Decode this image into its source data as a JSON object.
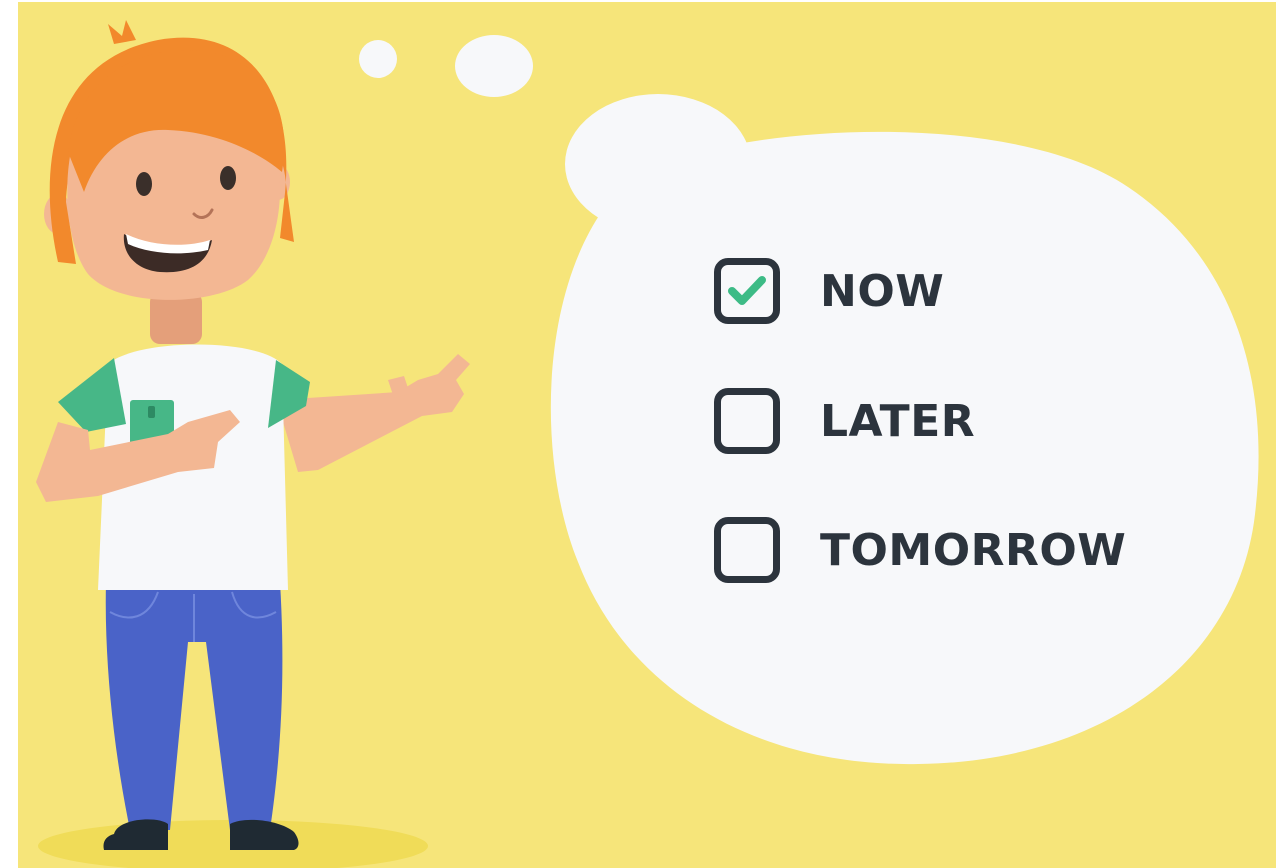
{
  "colors": {
    "background": "#f6e57a",
    "bubble": "#f7f8fa",
    "hair": "#f2892c",
    "skin": "#f3b793",
    "shirt_sleeves": "#47b787",
    "pants": "#4a63c8",
    "checkbox_border": "#2c343d",
    "checkmark": "#3dbb86"
  },
  "options": [
    {
      "label": "NOW",
      "checked": true
    },
    {
      "label": "LATER",
      "checked": false
    },
    {
      "label": "TOMORROW",
      "checked": false
    }
  ]
}
